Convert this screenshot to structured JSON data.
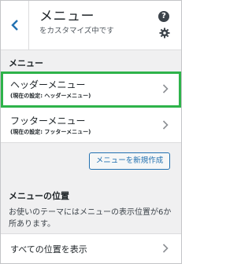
{
  "header": {
    "title": "メニュー",
    "subtitle": "をカスタマイズ中です",
    "help_glyph": "?"
  },
  "menus_section": {
    "heading": "メニュー",
    "items": [
      {
        "name": "ヘッダーメニュー",
        "current": "(現在の設定: ヘッダーメニュー)",
        "highlighted": true
      },
      {
        "name": "フッターメニュー",
        "current": "(現在の設定: フッターメニュー)",
        "highlighted": false
      }
    ],
    "new_menu_label": "メニューを新規作成"
  },
  "locations_section": {
    "heading": "メニューの位置",
    "description": "お使いのテーマにはメニューの表示位置が6か所あります。",
    "view_all_label": "すべての位置を表示"
  },
  "colors": {
    "highlight_border": "#2eb34a",
    "accent": "#2271b1",
    "back_arrow": "#2271b1"
  },
  "icons": [
    "back-arrow-icon",
    "help-icon",
    "gear-icon",
    "chevron-right-icon"
  ]
}
